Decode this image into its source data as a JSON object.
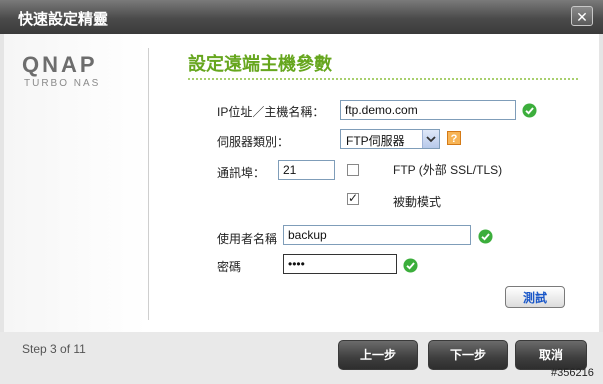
{
  "window": {
    "title": "快速設定精靈"
  },
  "brand": {
    "logo": "QNAP",
    "subtitle": "TURBO NAS"
  },
  "page": {
    "heading": "設定遠端主機參數"
  },
  "form": {
    "host_label": "IP位址／主機名稱：",
    "host_value": "ftp.demo.com",
    "server_type_label": "伺服器類別：",
    "server_type_value": "FTP伺服器",
    "port_label": "通訊埠：",
    "port_value": "21",
    "ftp_ssl_label": "FTP (外部 SSL/TLS)",
    "ftp_ssl_checked": false,
    "passive_label": "被動模式",
    "passive_checked": true,
    "username_label": "使用者名稱",
    "username_value": "backup",
    "password_label": "密碼",
    "password_value": "••••",
    "test_button": "測試",
    "help_glyph": "?"
  },
  "footer": {
    "step_text": "Step 3 of 11",
    "back_button": "上一步",
    "next_button": "下一步",
    "cancel_button": "取消",
    "watermark": "#356216"
  },
  "colors": {
    "heading": "#66a61e",
    "ok": "#3cae3c",
    "link": "#1a57c8"
  },
  "icons": {
    "close": "close-icon",
    "ok": "check-circle-icon",
    "help": "question-icon"
  }
}
